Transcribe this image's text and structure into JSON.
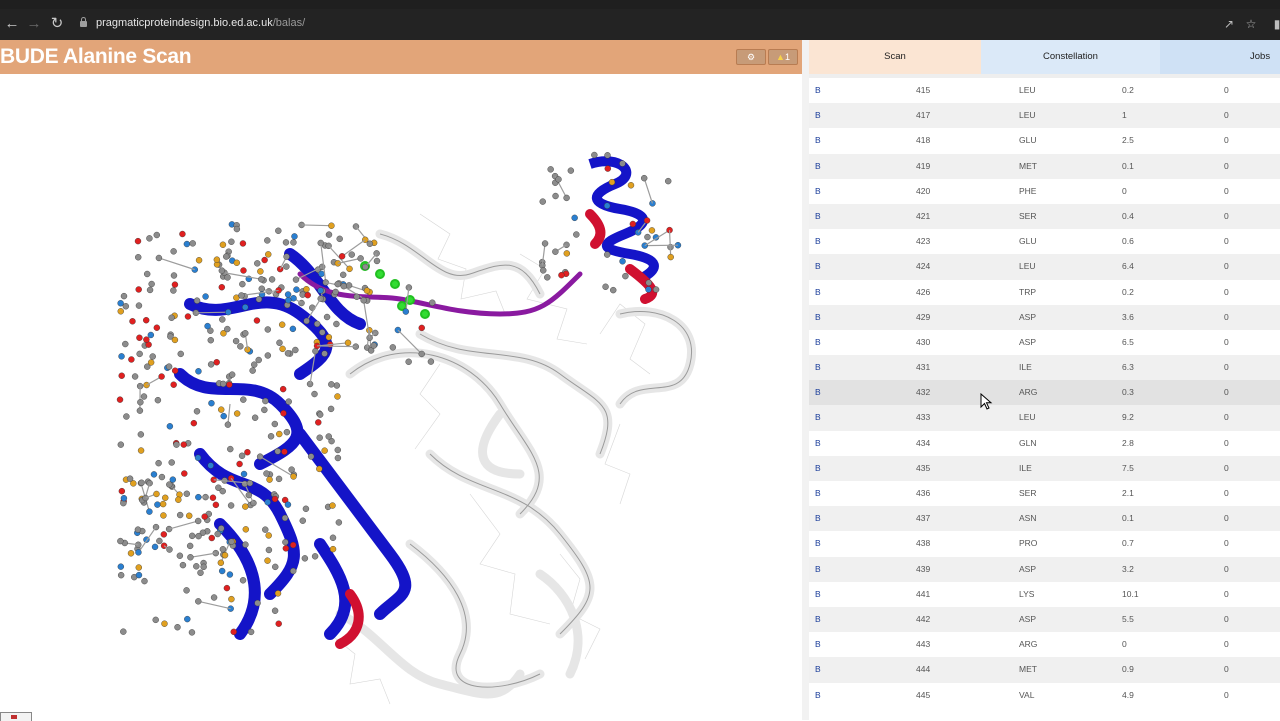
{
  "browser": {
    "url_host": "pragmaticproteindesign.bio.ed.ac.uk",
    "url_path": "/balas/",
    "icons": [
      "back-arrow-icon",
      "forward-arrow-icon",
      "reload-icon",
      "lock-icon",
      "share-icon",
      "star-icon"
    ]
  },
  "app": {
    "title": "BUDE Alanine Scan",
    "toolbar": {
      "settings_icon": "gear-icon",
      "warnings_icon": "warning-icon",
      "warnings_count": "1"
    }
  },
  "tabs": [
    {
      "label": "Scan"
    },
    {
      "label": "Constellation"
    },
    {
      "label": "Jobs"
    }
  ],
  "colors": {
    "header_bg": "#e2a579",
    "scan_tab_bg": "#fbe5d3",
    "constellation_tab_bg": "#dbe9f8",
    "chain_text": "#1a3d9a",
    "helix_blue": "#1414c8",
    "hotspot_red": "#d01030"
  },
  "rows": [
    {
      "chain": "B",
      "residue": "415",
      "aa": "LEU",
      "ddg": "0.2",
      "const": "0"
    },
    {
      "chain": "B",
      "residue": "417",
      "aa": "LEU",
      "ddg": "1",
      "const": "0"
    },
    {
      "chain": "B",
      "residue": "418",
      "aa": "GLU",
      "ddg": "2.5",
      "const": "0"
    },
    {
      "chain": "B",
      "residue": "419",
      "aa": "MET",
      "ddg": "0.1",
      "const": "0"
    },
    {
      "chain": "B",
      "residue": "420",
      "aa": "PHE",
      "ddg": "0",
      "const": "0"
    },
    {
      "chain": "B",
      "residue": "421",
      "aa": "SER",
      "ddg": "0.4",
      "const": "0"
    },
    {
      "chain": "B",
      "residue": "423",
      "aa": "GLU",
      "ddg": "0.6",
      "const": "0"
    },
    {
      "chain": "B",
      "residue": "424",
      "aa": "LEU",
      "ddg": "6.4",
      "const": "0"
    },
    {
      "chain": "B",
      "residue": "426",
      "aa": "TRP",
      "ddg": "0.2",
      "const": "0"
    },
    {
      "chain": "B",
      "residue": "429",
      "aa": "ASP",
      "ddg": "3.6",
      "const": "0"
    },
    {
      "chain": "B",
      "residue": "430",
      "aa": "ASP",
      "ddg": "6.5",
      "const": "0"
    },
    {
      "chain": "B",
      "residue": "431",
      "aa": "ILE",
      "ddg": "6.3",
      "const": "0"
    },
    {
      "chain": "B",
      "residue": "432",
      "aa": "ARG",
      "ddg": "0.3",
      "const": "0"
    },
    {
      "chain": "B",
      "residue": "433",
      "aa": "LEU",
      "ddg": "9.2",
      "const": "0"
    },
    {
      "chain": "B",
      "residue": "434",
      "aa": "GLN",
      "ddg": "2.8",
      "const": "0"
    },
    {
      "chain": "B",
      "residue": "435",
      "aa": "ILE",
      "ddg": "7.5",
      "const": "0"
    },
    {
      "chain": "B",
      "residue": "436",
      "aa": "SER",
      "ddg": "2.1",
      "const": "0"
    },
    {
      "chain": "B",
      "residue": "437",
      "aa": "ASN",
      "ddg": "0.1",
      "const": "0"
    },
    {
      "chain": "B",
      "residue": "438",
      "aa": "PRO",
      "ddg": "0.7",
      "const": "0"
    },
    {
      "chain": "B",
      "residue": "439",
      "aa": "ASP",
      "ddg": "3.2",
      "const": "0"
    },
    {
      "chain": "B",
      "residue": "441",
      "aa": "LYS",
      "ddg": "10.1",
      "const": "0"
    },
    {
      "chain": "B",
      "residue": "442",
      "aa": "ASP",
      "ddg": "5.5",
      "const": "0"
    },
    {
      "chain": "B",
      "residue": "443",
      "aa": "ARG",
      "ddg": "0",
      "const": "0"
    },
    {
      "chain": "B",
      "residue": "444",
      "aa": "MET",
      "ddg": "0.9",
      "const": "0"
    },
    {
      "chain": "B",
      "residue": "445",
      "aa": "VAL",
      "ddg": "4.9",
      "const": "0"
    }
  ],
  "hovered_row": 12
}
